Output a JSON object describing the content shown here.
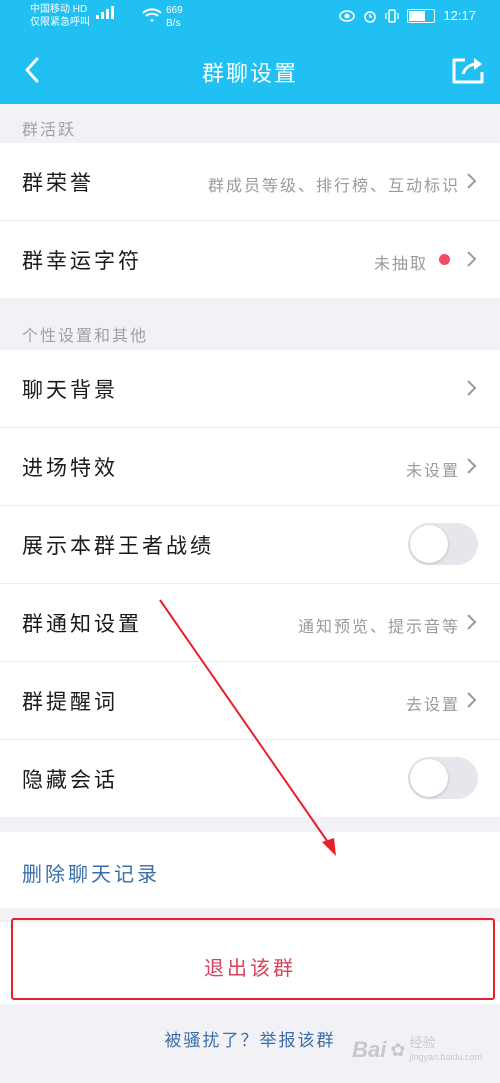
{
  "status_bar": {
    "carrier_line1": "中国移动 HD",
    "carrier_line2": "仅限紧急呼叫",
    "net_speed": "669",
    "net_speed_unit": "B/s",
    "time": "12:17"
  },
  "header": {
    "title": "群聊设置"
  },
  "sections": {
    "activity": {
      "label": "群活跃",
      "rows": [
        {
          "title": "群荣誉",
          "value": "群成员等级、排行榜、互动标识"
        },
        {
          "title": "群幸运字符",
          "value": "未抽取"
        }
      ]
    },
    "personal": {
      "label": "个性设置和其他",
      "rows": [
        {
          "title": "聊天背景",
          "value": ""
        },
        {
          "title": "进场特效",
          "value": "未设置"
        },
        {
          "title": "展示本群王者战绩",
          "value": ""
        },
        {
          "title": "群通知设置",
          "value": "通知预览、提示音等"
        },
        {
          "title": "群提醒词",
          "value": "去设置"
        },
        {
          "title": "隐藏会话",
          "value": ""
        }
      ]
    }
  },
  "toggles": {
    "show_kings_record": false,
    "hide_conversation": false
  },
  "actions": {
    "clear_history": "删除聊天记录",
    "exit_group": "退出该群",
    "report": "被骚扰了？举报该群"
  },
  "watermark": {
    "brand": "Bai",
    "brand_suffix": "经验",
    "domain": "jingyan.baidu.com"
  },
  "colors": {
    "header_bg": "#20c0f2",
    "link": "#3b6ea8",
    "danger": "#d8425c",
    "badge_dot": "#f04c64",
    "annotation": "#e8202a"
  }
}
